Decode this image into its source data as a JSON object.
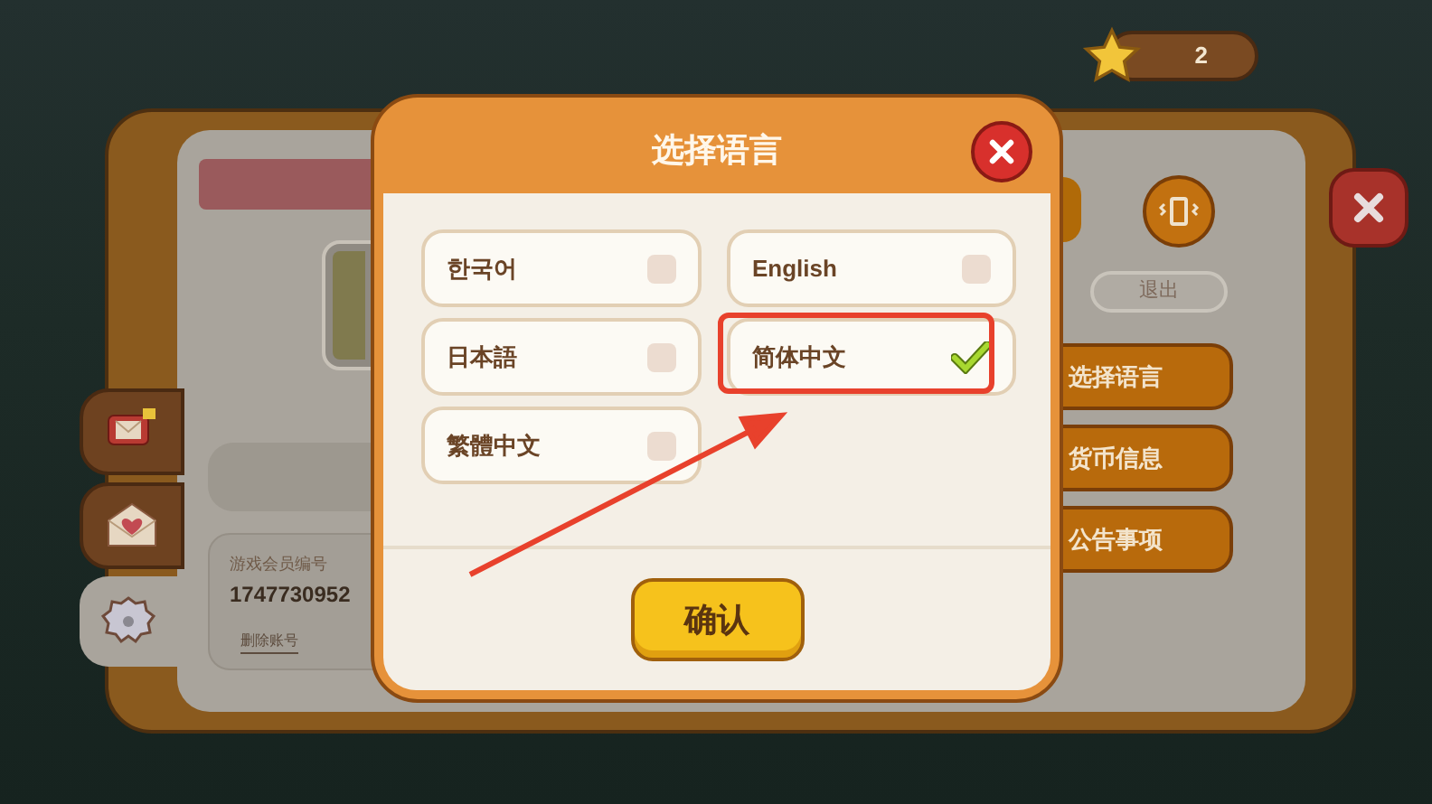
{
  "hud": {
    "star_count": "2"
  },
  "background_panel": {
    "member_id_label": "游戏会员编号",
    "member_id": "1747730952",
    "delete_account_link": "删除账号",
    "logout_button": "退出",
    "menu_buttons": [
      "选择语言",
      "货币信息",
      "公告事项"
    ],
    "side_tabs": [
      {
        "kind": "mail",
        "selected": false
      },
      {
        "kind": "letter",
        "selected": false
      },
      {
        "kind": "settings",
        "selected": true
      }
    ]
  },
  "dialog": {
    "title": "选择语言",
    "languages": [
      {
        "label": "한국어",
        "selected": false
      },
      {
        "label": "English",
        "selected": false
      },
      {
        "label": "日本語",
        "selected": false
      },
      {
        "label": "简体中文",
        "selected": true
      },
      {
        "label": "繁體中文",
        "selected": false
      }
    ],
    "confirm_button": "确认"
  }
}
